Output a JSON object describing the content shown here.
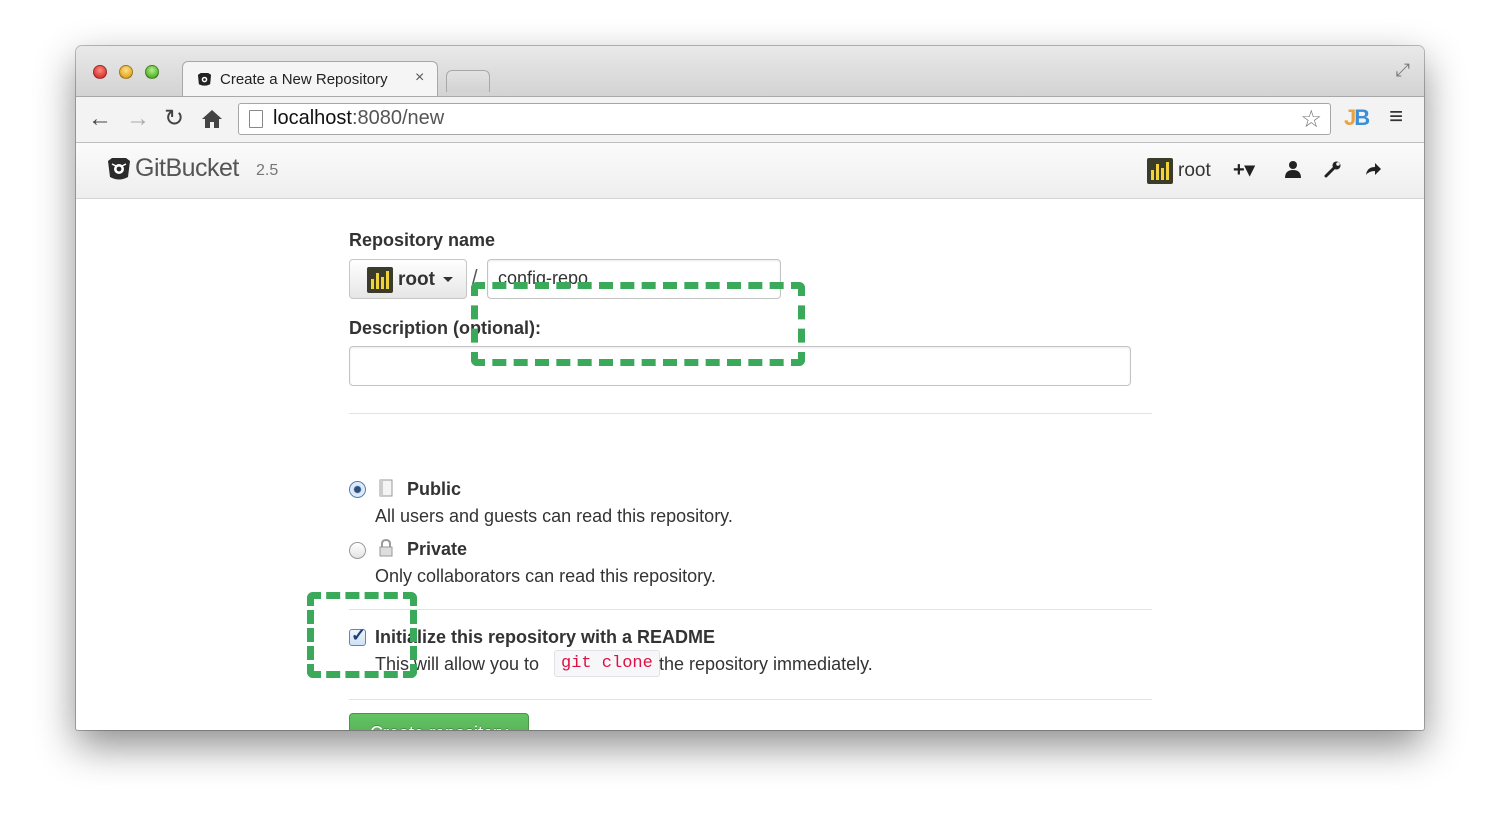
{
  "browser": {
    "tab_title": "Create a New Repository",
    "tab_close": "×",
    "url_host": "localhost",
    "url_rest": ":8080/new"
  },
  "gitbucket": {
    "app_name": "GitBucket",
    "version": "2.5",
    "user": "root"
  },
  "form": {
    "repo_name_label": "Repository name",
    "owner": "root",
    "separator": "/",
    "repo_name_value": "config-repo",
    "description_label": "Description (optional):",
    "description_value": "",
    "visibility": [
      {
        "title": "Public",
        "desc": "All users and guests can read this repository.",
        "checked": true
      },
      {
        "title": "Private",
        "desc": "Only collaborators can read this repository.",
        "checked": false
      }
    ],
    "readme_label": "Initialize this repository with a README",
    "readme_desc_before": "This will allow you to",
    "readme_code": "git clone",
    "readme_desc_after": "the repository immediately.",
    "readme_checked": true,
    "submit_label": "Create repository"
  },
  "colors": {
    "highlight": "#3aaa5a",
    "primary_button": "#5cb85c",
    "code_text": "#dd1144"
  }
}
